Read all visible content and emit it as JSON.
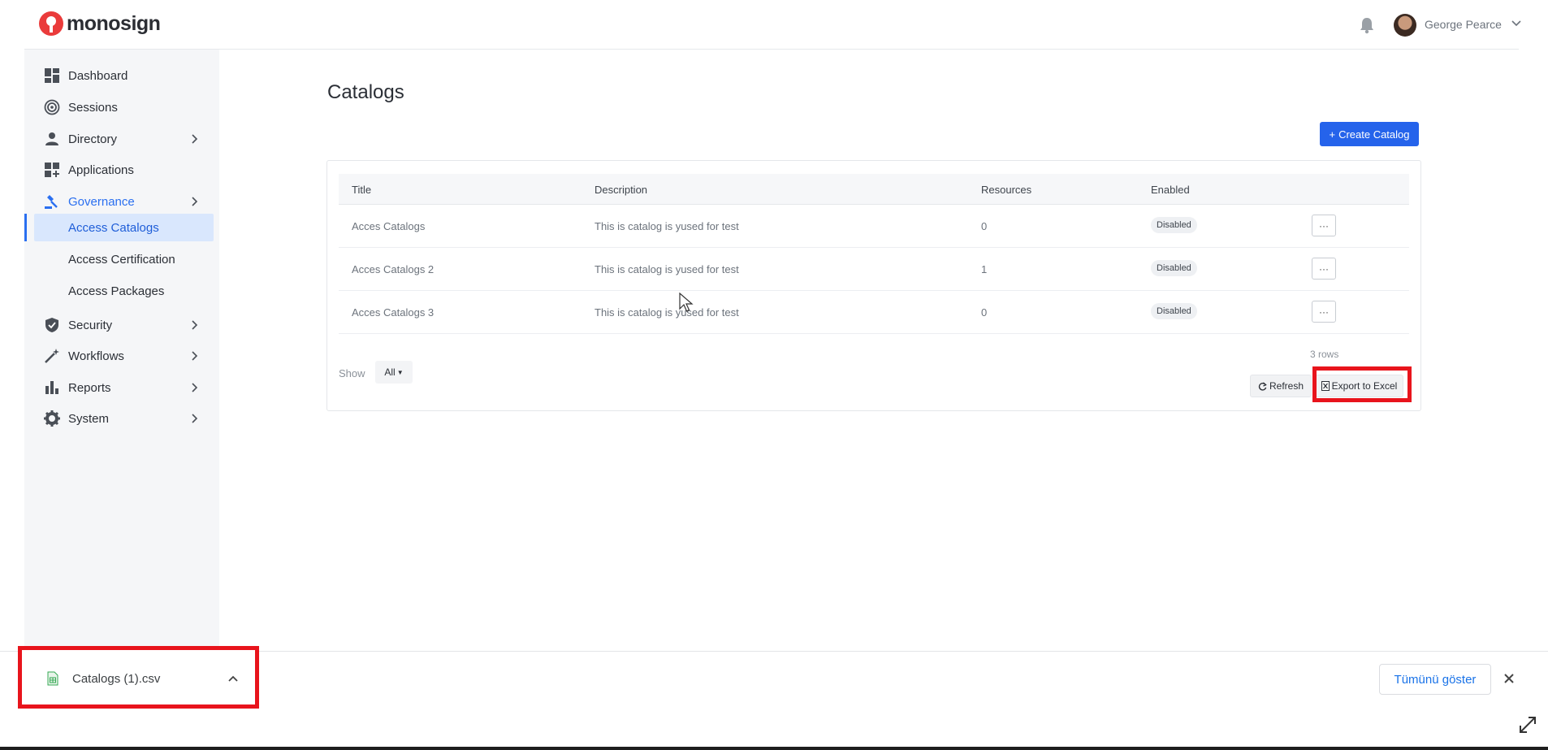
{
  "app": {
    "logo_text": "monosign",
    "brand_color": "#ea3b3b",
    "accent_color": "#2563eb"
  },
  "header": {
    "user_name": "George Pearce"
  },
  "sidebar": {
    "items": [
      {
        "label": "Dashboard",
        "icon": "dashboard-icon"
      },
      {
        "label": "Sessions",
        "icon": "sessions-icon"
      },
      {
        "label": "Directory",
        "icon": "person-icon"
      },
      {
        "label": "Applications",
        "icon": "applications-icon"
      },
      {
        "label": "Governance",
        "icon": "gavel-icon",
        "active": true
      },
      {
        "label": "Security",
        "icon": "shield-icon"
      },
      {
        "label": "Workflows",
        "icon": "magic-wand-icon"
      },
      {
        "label": "Reports",
        "icon": "bar-chart-icon"
      },
      {
        "label": "System",
        "icon": "gear-icon"
      }
    ],
    "governance_subitems": [
      {
        "label": "Access Catalogs",
        "selected": true
      },
      {
        "label": "Access Certification"
      },
      {
        "label": "Access Packages"
      }
    ]
  },
  "main": {
    "title": "Catalogs",
    "create_button": "Create Catalog",
    "columns": [
      "Title",
      "Description",
      "Resources",
      "Enabled"
    ],
    "rows": [
      {
        "title": "Acces Catalogs",
        "description": "This is catalog is yused for test",
        "resources": "0",
        "enabled": "Disabled",
        "actions": "···"
      },
      {
        "title": "Acces Catalogs 2",
        "description": "This is catalog is yused for test",
        "resources": "1",
        "enabled": "Disabled",
        "actions": "···"
      },
      {
        "title": "Acces Catalogs 3",
        "description": "This is catalog is yused for test",
        "resources": "0",
        "enabled": "Disabled",
        "actions": "···"
      }
    ],
    "rows_count": "3 rows",
    "show_label": "Show",
    "show_value": "All",
    "refresh_button": "Refresh",
    "export_button": "Export to Excel"
  },
  "download_bar": {
    "file_name": "Catalogs (1).csv",
    "show_all": "Tümünü göster"
  },
  "highlight_color": "#e8141c"
}
